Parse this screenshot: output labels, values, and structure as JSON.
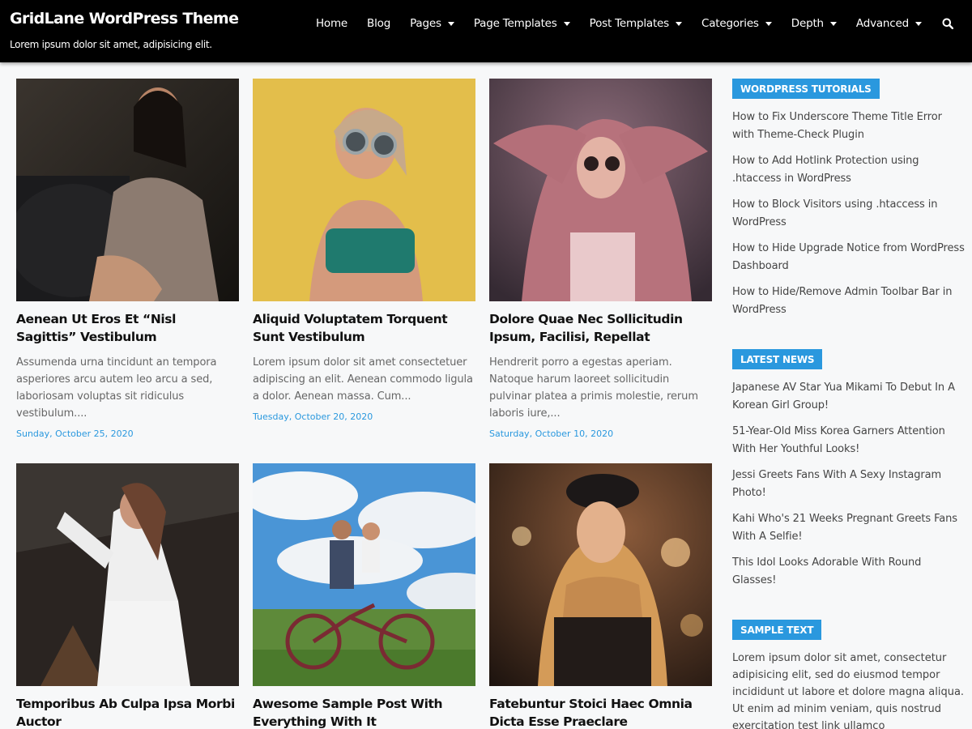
{
  "site": {
    "title": "GridLane WordPress Theme",
    "description": "Lorem ipsum dolor sit amet, adipisicing elit."
  },
  "nav": {
    "items": [
      {
        "label": "Home",
        "has_dropdown": false
      },
      {
        "label": "Blog",
        "has_dropdown": false
      },
      {
        "label": "Pages",
        "has_dropdown": true
      },
      {
        "label": "Page Templates",
        "has_dropdown": true
      },
      {
        "label": "Post Templates",
        "has_dropdown": true
      },
      {
        "label": "Categories",
        "has_dropdown": true
      },
      {
        "label": "Depth",
        "has_dropdown": true
      },
      {
        "label": "Advanced",
        "has_dropdown": true
      }
    ],
    "search_icon": "search-icon"
  },
  "posts": [
    {
      "title": "Aenean Ut Eros Et “Nisl Sagittis” Vestibulum",
      "excerpt": "Assumenda urna tincidunt an tempora asperiores arcu autem leo arcu a sed, laboriosam voluptas sit ridiculus vestibulum....",
      "date": "Sunday, October 25, 2020"
    },
    {
      "title": "Aliquid Voluptatem Torquent Sunt Vestibulum",
      "excerpt": "Lorem ipsum dolor sit amet consectetuer adipiscing an elit. Aenean commodo ligula a dolor. Aenean massa. Cum...",
      "date": "Tuesday, October 20, 2020"
    },
    {
      "title": "Dolore Quae Nec Sollicitudin Ipsum, Facilisi, Repellat",
      "excerpt": "Hendrerit porro a egestas aperiam. Natoque harum laoreet sollicitudin pulvinar platea a primis molestie, rerum laboris iure,...",
      "date": "Saturday, October 10, 2020"
    },
    {
      "title": "Temporibus Ab Culpa Ipsa Morbi Auctor"
    },
    {
      "title": "Awesome Sample Post With Everything With It"
    },
    {
      "title": "Fatebuntur Stoici Haec Omnia Dicta Esse Praeclare"
    }
  ],
  "sidebar": {
    "tutorials": {
      "title": "WORDPRESS TUTORIALS",
      "items": [
        "How to Fix Underscore Theme Title Error with Theme-Check Plugin",
        "How to Add Hotlink Protection using .htaccess in WordPress",
        "How to Block Visitors using .htaccess in WordPress",
        "How to Hide Upgrade Notice from WordPress Dashboard",
        "How to Hide/Remove Admin Toolbar Bar in WordPress"
      ]
    },
    "news": {
      "title": "LATEST NEWS",
      "items": [
        "Japanese AV Star Yua Mikami To Debut In A Korean Girl Group!",
        "51-Year-Old Miss Korea Garners Attention With Her Youthful Looks!",
        "Jessi Greets Fans With A Sexy Instagram Photo!",
        "Kahi Who's 21 Weeks Pregnant Greets Fans With A Selfie!",
        "This Idol Looks Adorable With Round Glasses!"
      ]
    },
    "sample_text": {
      "title": "SAMPLE TEXT",
      "body": "Lorem ipsum dolor sit amet, consectetur adipisicing elit, sed do eiusmod tempor incididunt ut labore et dolore magna aliqua. Ut enim ad minim veniam, quis nostrud exercitation test link ullamco"
    }
  },
  "colors": {
    "header_bg": "#000000",
    "accent": "#2a98de",
    "page_bg": "#f7f8f9"
  }
}
